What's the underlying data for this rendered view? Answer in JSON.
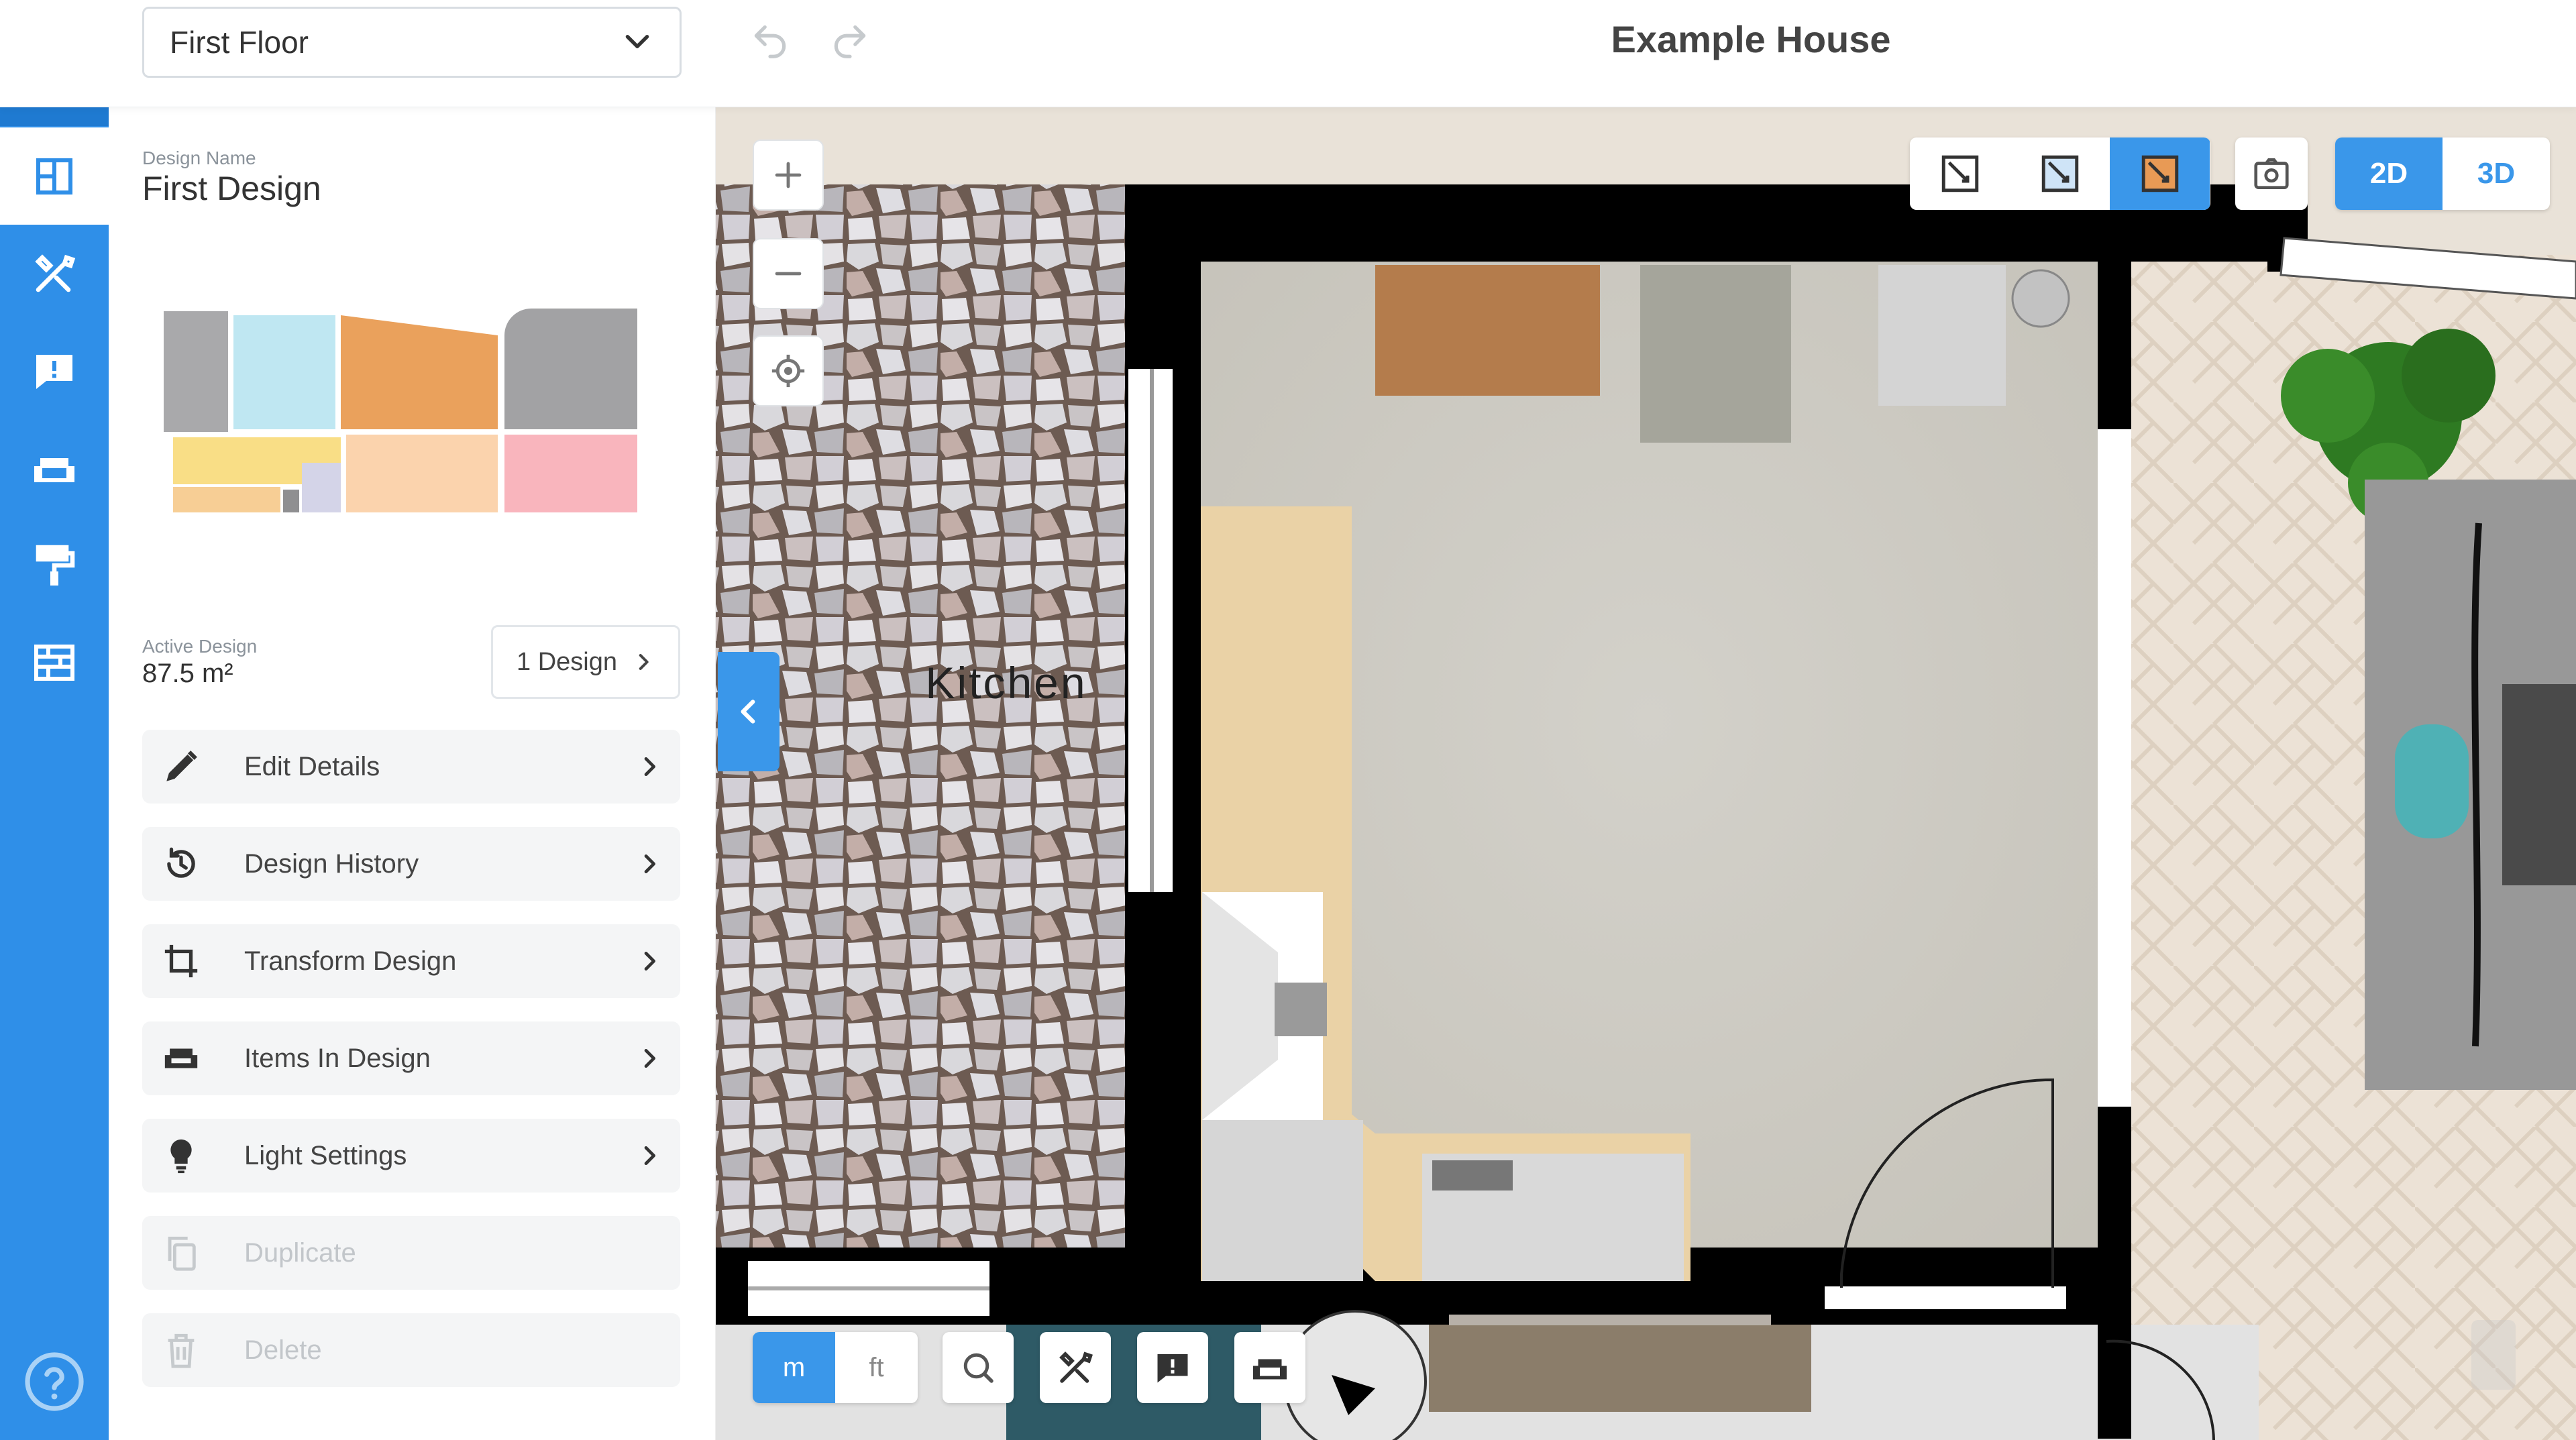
{
  "header": {
    "floor_selector_value": "First Floor",
    "house_title": "Example House"
  },
  "panel": {
    "design_name_label": "Design Name",
    "design_name": "First Design",
    "active_design_label": "Active Design",
    "active_design_area": "87.5 m²",
    "designs_button": "1 Design",
    "menu": [
      {
        "label": "Edit Details",
        "icon": "pencil-icon",
        "enabled": true
      },
      {
        "label": "Design History",
        "icon": "history-icon",
        "enabled": true
      },
      {
        "label": "Transform Design",
        "icon": "crop-icon",
        "enabled": true
      },
      {
        "label": "Items In Design",
        "icon": "sofa-icon",
        "enabled": true
      },
      {
        "label": "Light Settings",
        "icon": "bulb-icon",
        "enabled": true
      },
      {
        "label": "Duplicate",
        "icon": "copy-icon",
        "enabled": false
      },
      {
        "label": "Delete",
        "icon": "trash-icon",
        "enabled": false
      }
    ]
  },
  "rail": {
    "items": [
      "floorplan-icon",
      "build-tools-icon",
      "comment-icon",
      "furniture-icon",
      "paint-roller-icon",
      "brick-wall-icon"
    ],
    "active_index": 0,
    "help_icon": "help-icon"
  },
  "canvas": {
    "room_label": "Kitchen",
    "view_modes": [
      "wall-line-view-icon",
      "wall-fill-view-icon",
      "textured-view-icon"
    ],
    "active_view_mode": 2,
    "dimension_options": [
      "2D",
      "3D"
    ],
    "active_dimension": "2D",
    "unit_options": [
      "m",
      "ft"
    ],
    "active_unit": "m",
    "bottom_tools": [
      "search-icon",
      "build-tools-icon",
      "comment-icon",
      "furniture-icon"
    ]
  },
  "colors": {
    "accent": "#3a97ea",
    "rail": "#2f8fe8",
    "wall": "#000000"
  }
}
